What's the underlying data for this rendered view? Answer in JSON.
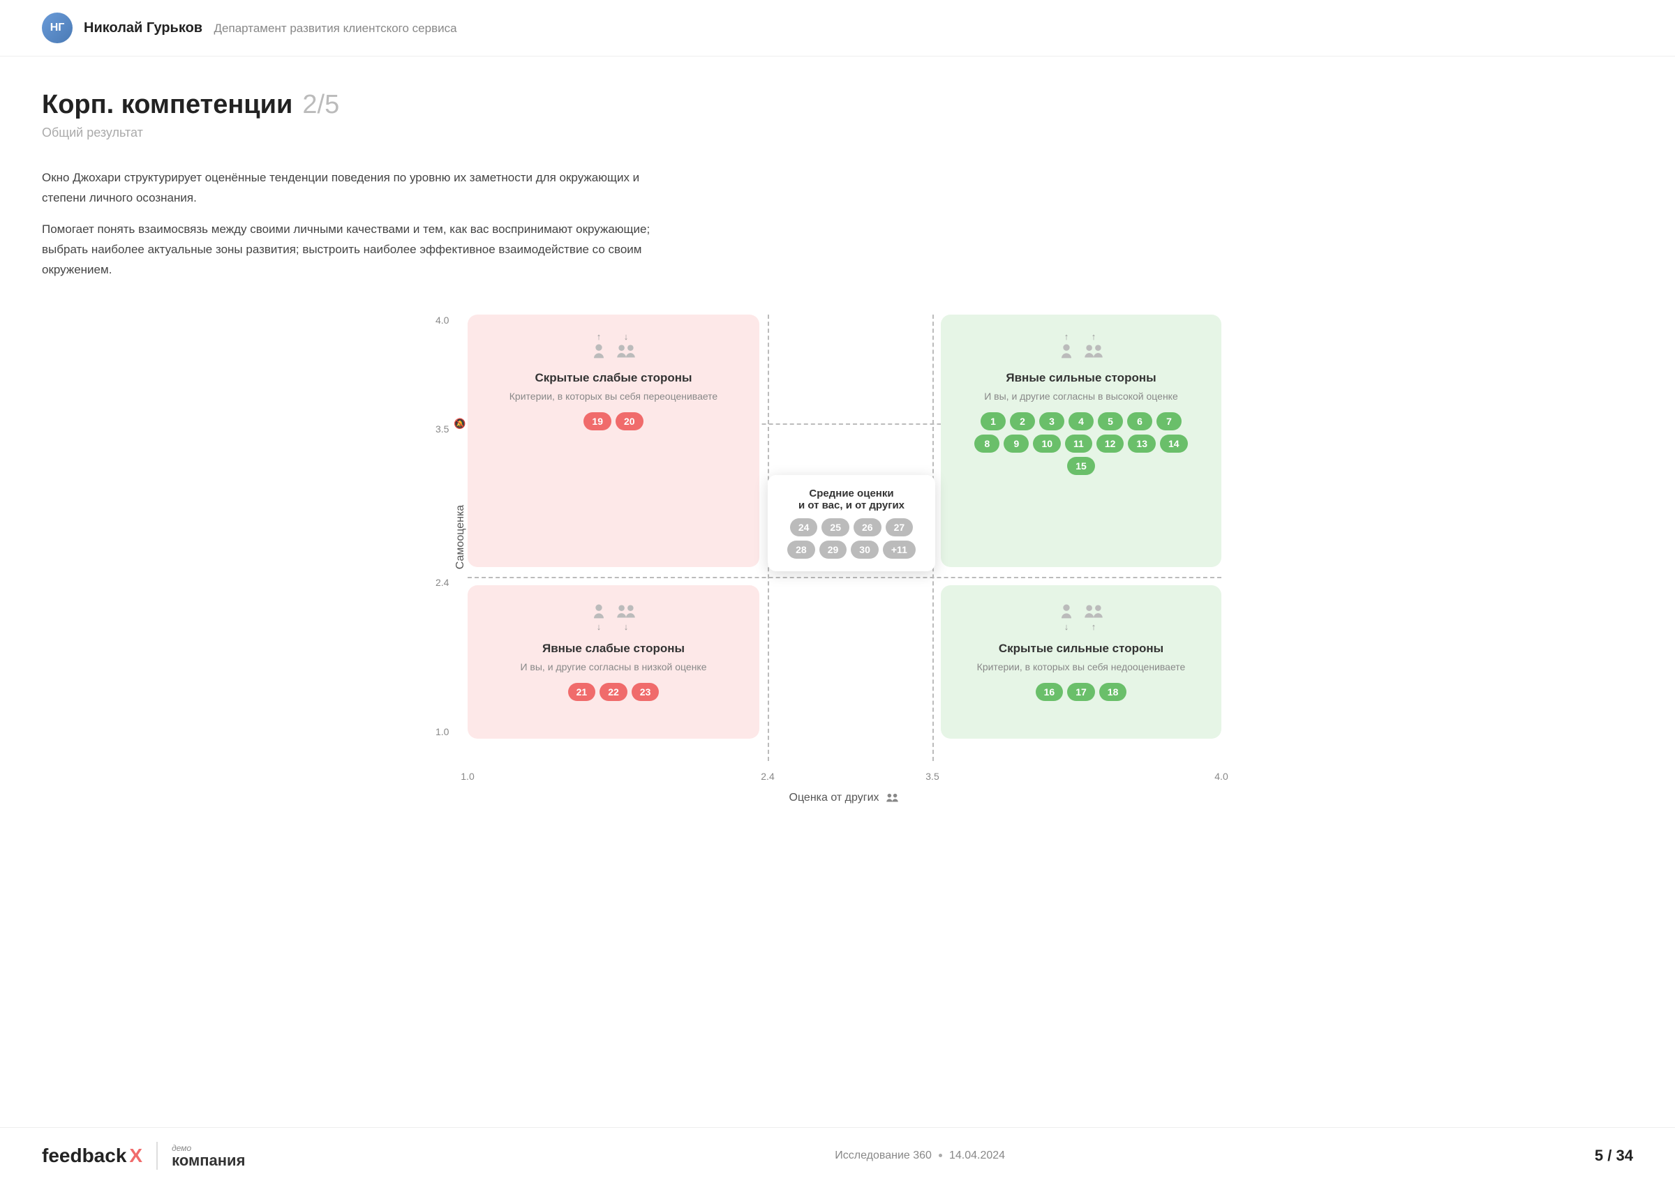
{
  "header": {
    "avatar_initials": "НГ",
    "name": "Николай Гурьков",
    "department": "Департамент развития клиентского сервиса"
  },
  "page": {
    "title": "Корп. компетенции",
    "progress": "2/5",
    "subtitle": "Общий результат",
    "desc1": "Окно Джохари структурирует оценённые тенденции поведения по уровню их заметности для окружающих и степени личного осознания.",
    "desc2": "Помогает понять взаимосвязь между своими личными качествами и тем, как вас воспринимают окружающие; выбрать наиболее актуальные зоны развития; выстроить наиболее эффективное взаимодействие со своим окружением."
  },
  "chart": {
    "y_label": "Самооценка",
    "x_label": "Оценка от других",
    "y_ticks": [
      "4.0",
      "3.5",
      "2.4",
      "1.0"
    ],
    "x_ticks": [
      "1.0",
      "2.4",
      "3.5",
      "4.0"
    ],
    "quadrants": {
      "top_left": {
        "title": "Скрытые слабые стороны",
        "desc": "Критерии, в которых вы себя переоцениваете",
        "badges": [
          "19",
          "20"
        ],
        "badge_type": "pink",
        "arrow_self": "up",
        "arrow_others": "down"
      },
      "top_right": {
        "title": "Явные сильные стороны",
        "desc": "И вы, и другие согласны в высокой оценке",
        "badges": [
          "1",
          "2",
          "3",
          "4",
          "5",
          "6",
          "7",
          "8",
          "9",
          "10",
          "11",
          "12",
          "13",
          "14",
          "15"
        ],
        "badge_type": "green",
        "arrow_self": "up",
        "arrow_others": "up"
      },
      "bottom_left": {
        "title": "Явные слабые стороны",
        "desc": "И вы, и другие согласны в низкой оценке",
        "badges": [
          "21",
          "22",
          "23"
        ],
        "badge_type": "pink",
        "arrow_self": "down",
        "arrow_others": "down"
      },
      "bottom_right": {
        "title": "Скрытые сильные стороны",
        "desc": "Критерии, в которых вы себя недооцениваете",
        "badges": [
          "16",
          "17",
          "18"
        ],
        "badge_type": "green",
        "arrow_self": "down",
        "arrow_others": "up"
      },
      "middle": {
        "title": "Средние оценки и от вас, и от других",
        "badges": [
          "24",
          "25",
          "26",
          "27",
          "28",
          "29",
          "30",
          "+11"
        ],
        "badge_type": "gray"
      }
    }
  },
  "footer": {
    "logo": "feedback",
    "logo_x": "X",
    "demo_label": "демо",
    "company": "компания",
    "study": "Исследование 360",
    "date": "14.04.2024",
    "page_current": "5",
    "page_total": "34"
  }
}
